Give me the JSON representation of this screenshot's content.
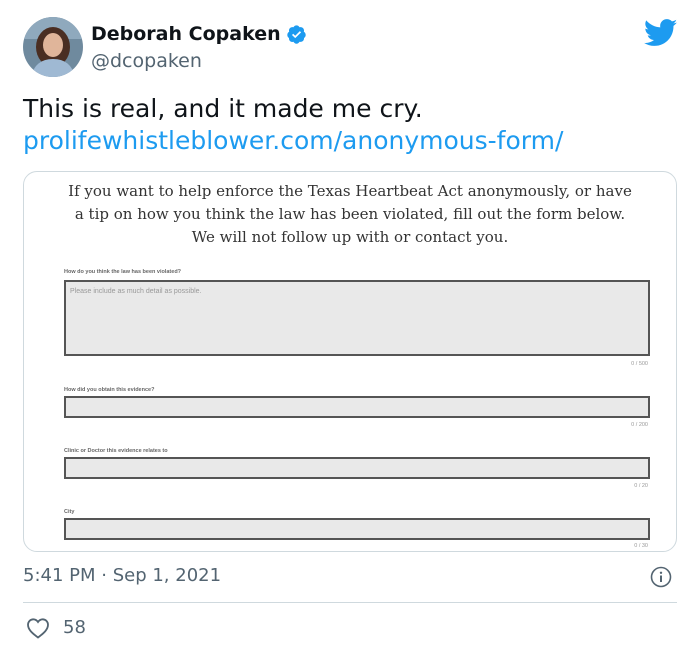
{
  "author": {
    "display_name": "Deborah Copaken",
    "handle": "@dcopaken",
    "verified": true
  },
  "tweet": {
    "text": "This is real, and it made me cry.",
    "link": "prolifewhistleblower.com/anonymous-form/"
  },
  "form": {
    "heading_lines": [
      "If you want to help enforce the Texas Heartbeat Act anonymously, or have",
      "a tip on how you think the law has been violated, fill out the form below.",
      "We will not follow up with or contact you."
    ],
    "fields": [
      {
        "label": "How do you think the law has been violated?",
        "placeholder": "Please include as much detail as possible.",
        "counter": "0 / 500"
      },
      {
        "label": "How did you obtain this evidence?",
        "placeholder": "",
        "counter": "0 / 200"
      },
      {
        "label": "Clinic or Doctor this evidence relates to",
        "placeholder": "",
        "counter": "0 / 20"
      },
      {
        "label": "City",
        "placeholder": "",
        "counter": "0 / 30"
      }
    ]
  },
  "meta": {
    "timestamp": "5:41 PM · Sep 1, 2021",
    "like_count": "58"
  },
  "colors": {
    "link": "#1d9bf0",
    "verified": "#1d9bf0",
    "secondary_text": "#536471",
    "twitter_logo": "#1d9bf0"
  },
  "icons": [
    "avatar",
    "verified-badge-icon",
    "twitter-logo-icon",
    "info-icon",
    "heart-icon"
  ]
}
